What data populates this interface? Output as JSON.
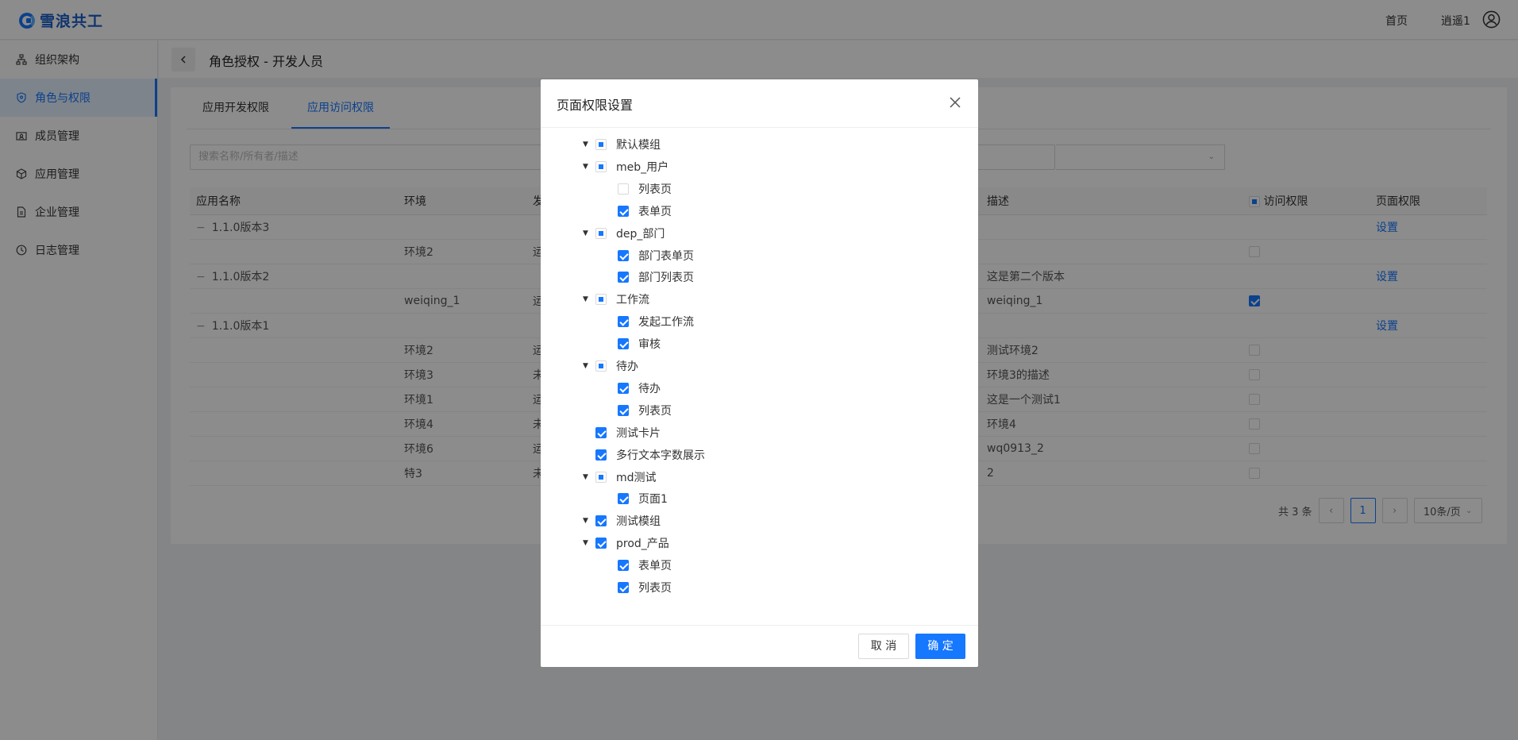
{
  "header": {
    "logo": "雪浪共工",
    "home": "首页",
    "user": "逍遥1"
  },
  "sidebar": {
    "items": [
      {
        "label": "组织架构",
        "icon": "org-icon"
      },
      {
        "label": "角色与权限",
        "icon": "shield-icon",
        "active": true
      },
      {
        "label": "成员管理",
        "icon": "member-icon"
      },
      {
        "label": "应用管理",
        "icon": "cube-icon"
      },
      {
        "label": "企业管理",
        "icon": "doc-icon"
      },
      {
        "label": "日志管理",
        "icon": "clock-icon"
      }
    ]
  },
  "page": {
    "title": "角色授权 - 开发人员"
  },
  "tabs": [
    {
      "label": "应用开发权限"
    },
    {
      "label": "应用访问权限",
      "active": true
    }
  ],
  "search": {
    "placeholder": "搜索名称/所有者/描述"
  },
  "table": {
    "headers": [
      "应用名称",
      "环境",
      "发",
      "描述",
      "访问权限",
      "页面权限"
    ],
    "rows": [
      {
        "name": "1.1.0版本3",
        "group": true,
        "setting": "设置"
      },
      {
        "env": "环境2",
        "pub": "运",
        "desc": "",
        "checked": false
      },
      {
        "name": "1.1.0版本2",
        "group": true,
        "desc": "这是第二个版本",
        "setting": "设置"
      },
      {
        "env": "weiqing_1",
        "pub": "运",
        "desc": "weiqing_1",
        "checked": true
      },
      {
        "name": "1.1.0版本1",
        "group": true,
        "setting": "设置"
      },
      {
        "env": "环境2",
        "pub": "运",
        "desc": "测试环境2",
        "checked": false
      },
      {
        "env": "环境3",
        "pub": "未",
        "desc": "环境3的描述",
        "checked": false
      },
      {
        "env": "环境1",
        "pub": "运",
        "desc": "这是一个测试1",
        "checked": false
      },
      {
        "env": "环境4",
        "pub": "未",
        "desc": "环境4",
        "checked": false
      },
      {
        "env": "环境6",
        "pub": "运",
        "desc": "wq0913_2",
        "checked": false
      },
      {
        "env": "特3",
        "pub": "未",
        "desc": "2",
        "checked": false
      }
    ]
  },
  "pager": {
    "total": "共 3 条",
    "current": "1",
    "size": "10条/页"
  },
  "modal": {
    "title": "页面权限设置",
    "cancel": "取 消",
    "ok": "确 定",
    "tree": [
      {
        "label": "默认模组",
        "level": 0,
        "caret": true,
        "state": "half"
      },
      {
        "label": "meb_用户",
        "level": 0,
        "caret": true,
        "state": "half"
      },
      {
        "label": "列表页",
        "level": 1,
        "state": "off"
      },
      {
        "label": "表单页",
        "level": 1,
        "state": "on"
      },
      {
        "label": "dep_部门",
        "level": 0,
        "caret": true,
        "state": "half"
      },
      {
        "label": "部门表单页",
        "level": 1,
        "state": "on"
      },
      {
        "label": "部门列表页",
        "level": 1,
        "state": "on"
      },
      {
        "label": "工作流",
        "level": 0,
        "caret": true,
        "state": "half"
      },
      {
        "label": "发起工作流",
        "level": 1,
        "state": "on"
      },
      {
        "label": "审核",
        "level": 1,
        "state": "on"
      },
      {
        "label": "待办",
        "level": 0,
        "caret": true,
        "state": "half"
      },
      {
        "label": "待办",
        "level": 1,
        "state": "on"
      },
      {
        "label": "列表页",
        "level": 1,
        "state": "on"
      },
      {
        "label": "测试卡片",
        "level": 0,
        "state": "on"
      },
      {
        "label": "多行文本字数展示",
        "level": 0,
        "state": "on"
      },
      {
        "label": "md测试",
        "level": 0,
        "caret": true,
        "state": "half"
      },
      {
        "label": "页面1",
        "level": 1,
        "state": "on"
      },
      {
        "label": "测试模组",
        "level": 0,
        "caret": true,
        "state": "on"
      },
      {
        "label": "prod_产品",
        "level": 0,
        "caret": true,
        "state": "on"
      },
      {
        "label": "表单页",
        "level": 1,
        "state": "on"
      },
      {
        "label": "列表页",
        "level": 1,
        "state": "on"
      }
    ]
  },
  "colors": {
    "accent": "#1677ff",
    "mask": "rgba(0,0,0,0.45)"
  }
}
